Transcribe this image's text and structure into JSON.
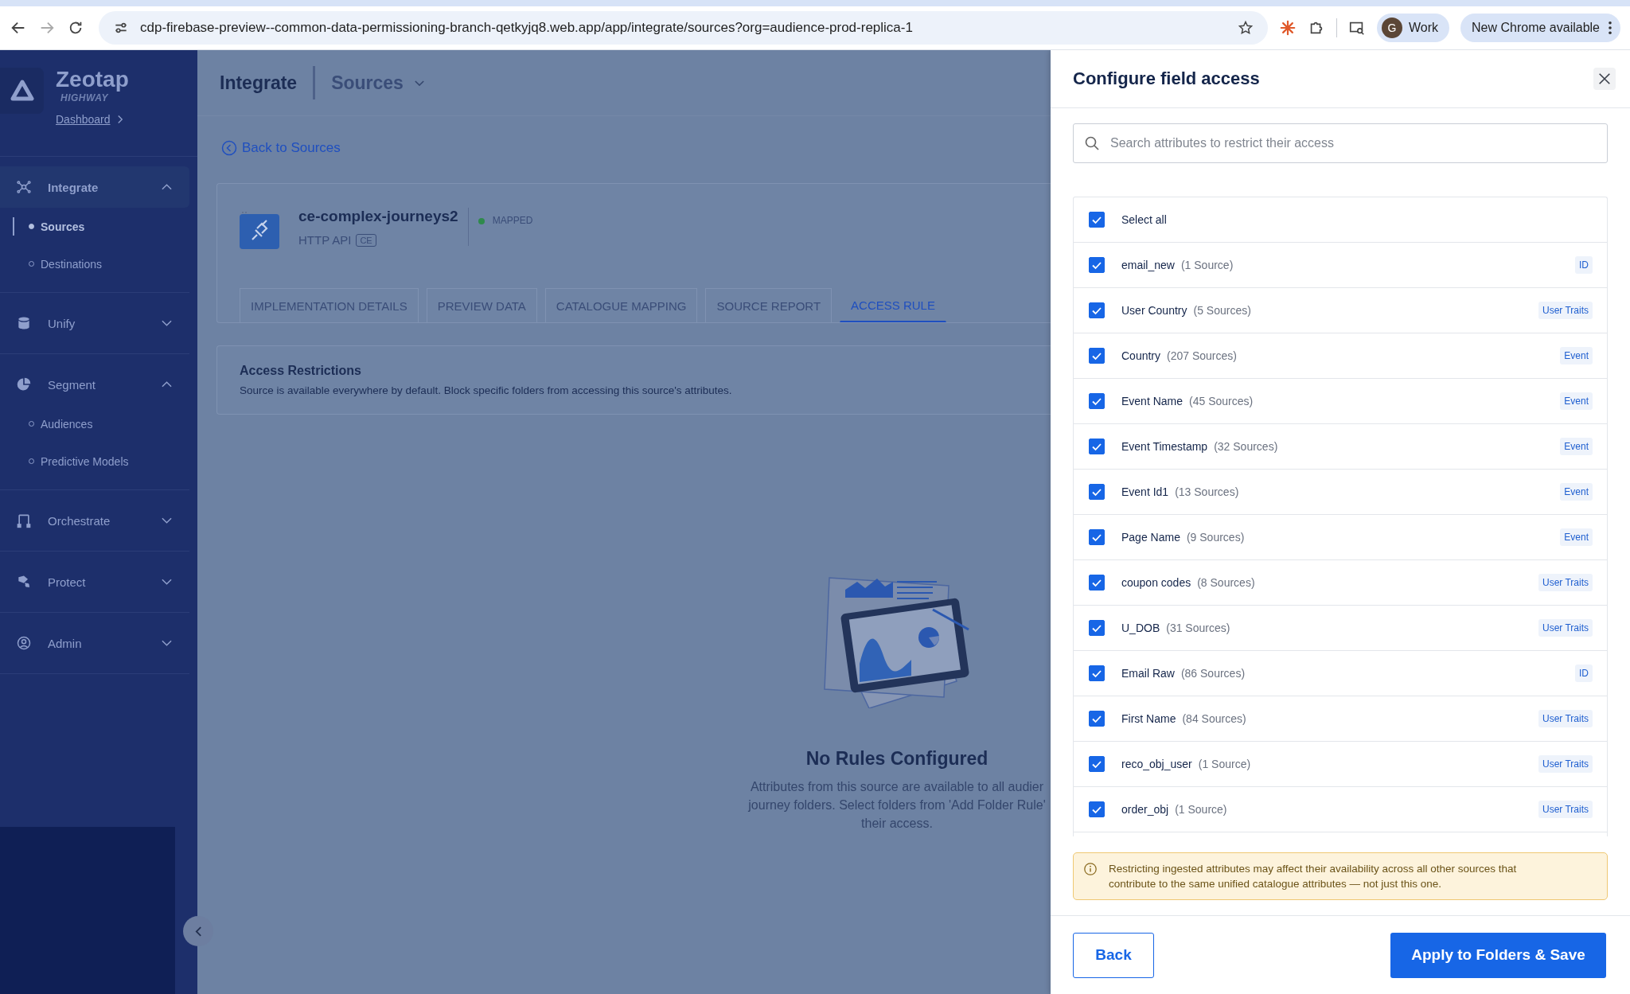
{
  "browser": {
    "url": "cdp-firebase-preview--common-data-permissioning-branch-qetkyjq8.web.app/app/integrate/sources?org=audience-prod-replica-1",
    "profile": {
      "initial": "G",
      "label": "Work"
    },
    "update_label": "New Chrome available"
  },
  "sidebar": {
    "brand": "Zeotap",
    "subtitle": "HIGHWAY",
    "breadcrumb": "Dashboard",
    "sections": [
      {
        "label": "Integrate",
        "selected": true,
        "expanded": true,
        "children": [
          {
            "label": "Sources",
            "selected": true
          },
          {
            "label": "Destinations",
            "selected": false
          }
        ]
      },
      {
        "label": "Unify",
        "selected": false,
        "expanded": false
      },
      {
        "label": "Segment",
        "selected": false,
        "expanded": true,
        "children": [
          {
            "label": "Audiences",
            "selected": false
          },
          {
            "label": "Predictive Models",
            "selected": false
          }
        ]
      },
      {
        "label": "Orchestrate",
        "selected": false,
        "expanded": false
      },
      {
        "label": "Protect",
        "selected": false,
        "expanded": false
      },
      {
        "label": "Admin",
        "selected": false,
        "expanded": false
      }
    ]
  },
  "main": {
    "header": {
      "title": "Integrate",
      "section": "Sources"
    },
    "back_link": "Back to Sources",
    "source": {
      "name": "ce-complex-journeys2",
      "type": "HTTP API",
      "type_badge": "CE",
      "status": "MAPPED"
    },
    "tabs": [
      {
        "label": "IMPLEMENTATION DETAILS",
        "selected": false
      },
      {
        "label": "PREVIEW DATA",
        "selected": false
      },
      {
        "label": "CATALOGUE MAPPING",
        "selected": false
      },
      {
        "label": "SOURCE REPORT",
        "selected": false
      },
      {
        "label": "ACCESS RULE",
        "selected": true
      }
    ],
    "restrictions": {
      "title": "Access Restrictions",
      "text": "Source is available everywhere by default. Block specific folders from accessing this source's attributes."
    },
    "empty_state": {
      "title": "No Rules Configured",
      "lines": [
        "Attributes from this source are available to all audier",
        "journey folders. Select folders from 'Add Folder Rule'",
        "their access."
      ]
    }
  },
  "drawer": {
    "title": "Configure field access",
    "search": {
      "placeholder": "Search attributes to restrict their access"
    },
    "select_all": {
      "label": "Select all",
      "checked": true
    },
    "attributes": [
      {
        "name": "email_new",
        "count": "(1 Source)",
        "tag": "ID",
        "checked": true
      },
      {
        "name": "User Country",
        "count": "(5 Sources)",
        "tag": "User Traits",
        "checked": true
      },
      {
        "name": "Country",
        "count": "(207 Sources)",
        "tag": "Event",
        "checked": true
      },
      {
        "name": "Event Name",
        "count": "(45 Sources)",
        "tag": "Event",
        "checked": true
      },
      {
        "name": "Event Timestamp",
        "count": "(32 Sources)",
        "tag": "Event",
        "checked": true
      },
      {
        "name": "Event Id1",
        "count": "(13 Sources)",
        "tag": "Event",
        "checked": true
      },
      {
        "name": "Page Name",
        "count": "(9 Sources)",
        "tag": "Event",
        "checked": true
      },
      {
        "name": "coupon codes",
        "count": "(8 Sources)",
        "tag": "User Traits",
        "checked": true
      },
      {
        "name": "U_DOB",
        "count": "(31 Sources)",
        "tag": "User Traits",
        "checked": true
      },
      {
        "name": "Email Raw",
        "count": "(86 Sources)",
        "tag": "ID",
        "checked": true
      },
      {
        "name": "First Name",
        "count": "(84 Sources)",
        "tag": "User Traits",
        "checked": true
      },
      {
        "name": "reco_obj_user",
        "count": "(1 Source)",
        "tag": "User Traits",
        "checked": true
      },
      {
        "name": "order_obj",
        "count": "(1 Source)",
        "tag": "User Traits",
        "checked": true
      }
    ],
    "warning": "Restricting ingested attributes may affect their availability across all other sources that contribute to the same unified catalogue attributes — not just this one.",
    "back_button": "Back",
    "save_button": "Apply to Folders & Save"
  }
}
